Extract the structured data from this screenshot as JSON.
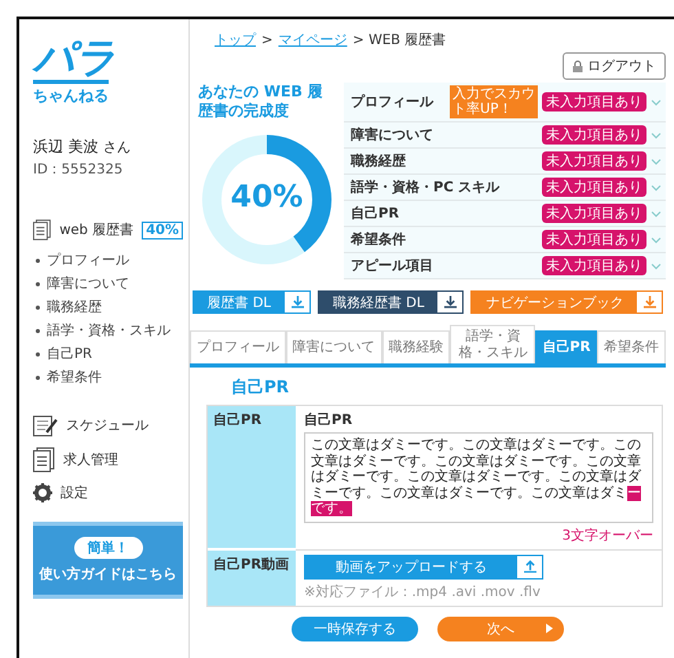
{
  "logo": {
    "title": "パラ",
    "subtitle": "ちゃんねる"
  },
  "user": {
    "name": "浜辺 美波",
    "honorific": "さん",
    "id": "ID：5552325"
  },
  "sidebar": {
    "resume": {
      "label": "web 履歴書",
      "badge": "40%"
    },
    "sub_items": [
      "プロフィール",
      "障害について",
      "職務経歴",
      "語学・資格・スキル",
      "自己PR",
      "希望条件"
    ],
    "items": [
      {
        "kind": "schedule",
        "label": "スケジュール"
      },
      {
        "kind": "jobs",
        "label": "求人管理"
      },
      {
        "kind": "settings",
        "label": "設定"
      }
    ],
    "guide": {
      "pill": "簡単！",
      "label": "使い方ガイドはこちら"
    }
  },
  "breadcrumb": [
    {
      "label": "トップ",
      "link": true
    },
    {
      "label": ">",
      "link": false
    },
    {
      "label": "マイページ",
      "link": true
    },
    {
      "label": "> WEB 履歴書",
      "link": false
    }
  ],
  "logout": "ログアウト",
  "completion": {
    "title": "あなたの WEB 履歴書の完成度",
    "value": "40%",
    "level": 0.4
  },
  "sections": [
    {
      "label": "プロフィール",
      "tooltip": "入力でスカウト率UP！",
      "status": "未入力項目あり"
    },
    {
      "label": "障害について",
      "status": "未入力項目あり"
    },
    {
      "label": "職務経歴",
      "status": "未入力項目あり"
    },
    {
      "label": "語学・資格・PC スキル",
      "status": "未入力項目あり"
    },
    {
      "label": "自己PR",
      "status": "未入力項目あり"
    },
    {
      "label": "希望条件",
      "status": "未入力項目あり"
    },
    {
      "label": "アピール項目",
      "status": "未入力項目あり"
    }
  ],
  "downloads": [
    {
      "label": "履歴書 DL",
      "color": "#1a9be0"
    },
    {
      "label": "職務経歴書 DL",
      "color": "#2e4d6b"
    },
    {
      "label": "ナビゲーションブック",
      "color": "#f5821f"
    }
  ],
  "tabs": [
    {
      "label": "プロフィール",
      "selected": false
    },
    {
      "label": "障害について",
      "selected": false
    },
    {
      "label": "職務経験",
      "selected": false
    },
    {
      "label": "語学・資格・スキル",
      "selected": false
    },
    {
      "label": "自己PR",
      "selected": true
    },
    {
      "label": "希望条件",
      "selected": false
    }
  ],
  "form": {
    "heading": "自己PR",
    "pr": {
      "label": "自己PR",
      "field_label": "自己PR",
      "text": "この文章はダミーです。この文章はダミーです。この文章はダミーです。この文章はダミーです。この文章はダミーです。この文章はダミーです。この文章はダミーです。この文章はダミーです。この文章はダミ",
      "overflow": "ーです。",
      "warning": "3文字オーバー"
    },
    "video": {
      "label": "自己PR動画",
      "button": "動画をアップロードする",
      "note": "※対応ファイル：.mp4 .avi .mov .flv"
    }
  },
  "actions": [
    {
      "kind": "save",
      "label": "一時保存する"
    },
    {
      "kind": "next",
      "label": "次へ"
    }
  ]
}
